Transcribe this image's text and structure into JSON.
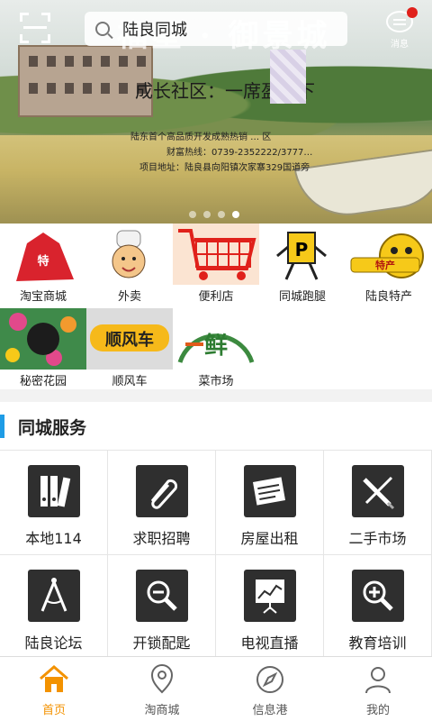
{
  "header": {
    "search_value": "陆良同城",
    "message_label": "消息",
    "has_unread": true
  },
  "banner": {
    "headline": "福星 · 御景城",
    "slogan": "成长社区：一席盈天下",
    "line1": "陆东首个高品质开发成熟热销 … 区",
    "line2": "财富热线：0739-2352222/3777…",
    "line3": "项目地址：陆良县向阳镇次家寨329国道旁",
    "slides": 4,
    "active_slide": 4
  },
  "quick_entries": [
    {
      "label": "淘宝商城",
      "icon": "taobao-mall-icon"
    },
    {
      "label": "外卖",
      "icon": "chef-icon"
    },
    {
      "label": "便利店",
      "icon": "shopping-basket-icon"
    },
    {
      "label": "同城跑腿",
      "icon": "parking-sign-icon"
    },
    {
      "label": "陆良特产",
      "icon": "specialty-icon"
    },
    {
      "label": "秘密花园",
      "icon": "secret-garden-icon"
    },
    {
      "label": "顺风车",
      "icon": "ride-share-icon"
    },
    {
      "label": "菜市场",
      "icon": "vegetable-market-icon"
    }
  ],
  "service_section": {
    "title": "同城服务",
    "accent": "#1e9ce6",
    "items": [
      {
        "label": "本地114",
        "icon": "binders-icon"
      },
      {
        "label": "求职招聘",
        "icon": "paperclip-icon"
      },
      {
        "label": "房屋出租",
        "icon": "newspaper-icon"
      },
      {
        "label": "二手市场",
        "icon": "pen-tools-icon"
      },
      {
        "label": "陆良论坛",
        "icon": "compass-tool-icon"
      },
      {
        "label": "开锁配匙",
        "icon": "zoom-out-icon"
      },
      {
        "label": "电视直播",
        "icon": "chart-board-icon"
      },
      {
        "label": "教育培训",
        "icon": "zoom-in-icon"
      }
    ]
  },
  "tabbar": {
    "active_color": "#f39200",
    "items": [
      {
        "label": "首页",
        "icon": "home-icon"
      },
      {
        "label": "淘商城",
        "icon": "location-icon"
      },
      {
        "label": "信息港",
        "icon": "compass-icon"
      },
      {
        "label": "我的",
        "icon": "user-icon"
      }
    ],
    "active_index": 0
  }
}
